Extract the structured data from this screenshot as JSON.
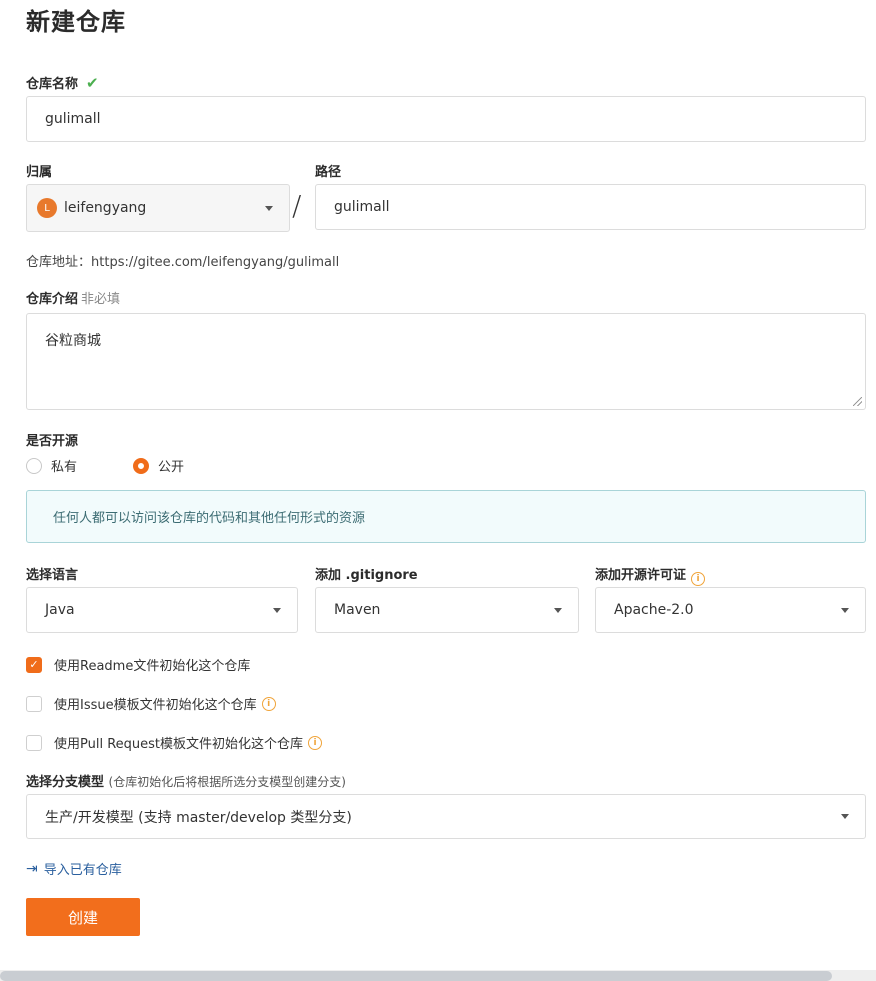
{
  "page_title": "新建仓库",
  "repo_name": {
    "label": "仓库名称",
    "valid_mark": "✔",
    "value": "gulimall"
  },
  "owner": {
    "label": "归属",
    "avatar_letter": "L",
    "value": "leifengyang"
  },
  "path": {
    "label": "路径",
    "separator": "/",
    "value": "gulimall"
  },
  "address": {
    "label": "仓库地址：",
    "url": "https://gitee.com/leifengyang/gulimall"
  },
  "intro": {
    "label": "仓库介绍",
    "optional": "非必填",
    "value": "谷粒商城"
  },
  "visibility": {
    "label": "是否开源",
    "options": [
      {
        "label": "私有",
        "selected": false
      },
      {
        "label": "公开",
        "selected": true
      }
    ],
    "notice": "任何人都可以访问该仓库的代码和其他任何形式的资源"
  },
  "language": {
    "label": "选择语言",
    "value": "Java"
  },
  "gitignore": {
    "label": "添加 .gitignore",
    "value": "Maven"
  },
  "license": {
    "label": "添加开源许可证",
    "value": "Apache-2.0"
  },
  "init_options": [
    {
      "label": "使用Readme文件初始化这个仓库",
      "checked": true,
      "info": false
    },
    {
      "label": "使用Issue模板文件初始化这个仓库",
      "checked": false,
      "info": true
    },
    {
      "label": "使用Pull Request模板文件初始化这个仓库",
      "checked": false,
      "info": true
    }
  ],
  "branch_model": {
    "label": "选择分支模型",
    "hint": "(仓库初始化后将根据所选分支模型创建分支)",
    "value": "生产/开发模型 (支持 master/develop 类型分支)"
  },
  "import_link": "导入已有仓库",
  "create_button": "创建",
  "colors": {
    "accent": "#f26e1c",
    "notice_bg": "#f2fbfc",
    "notice_border": "#a9d4d8",
    "link": "#2a5f9e",
    "valid": "#4caf50"
  }
}
